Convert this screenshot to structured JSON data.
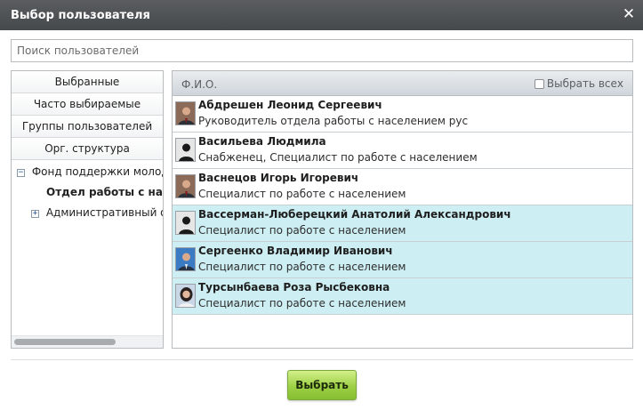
{
  "dialog": {
    "title": "Выбор пользователя"
  },
  "search": {
    "placeholder": "Поиск пользователей",
    "value": ""
  },
  "sidebar": {
    "items": [
      {
        "label": "Выбранные"
      },
      {
        "label": "Часто выбираемые"
      },
      {
        "label": "Группы пользователей"
      },
      {
        "label": "Орг. структура"
      }
    ],
    "tree": [
      {
        "label": "Фонд поддержки молоде",
        "toggle": "−",
        "expanded": true
      },
      {
        "label": "Отдел работы с нас",
        "toggle": "",
        "active": true
      },
      {
        "label": "Административный от",
        "toggle": "+",
        "expanded": false
      }
    ]
  },
  "list": {
    "header_label": "Ф.И.О.",
    "select_all_label": "Выбрать всех",
    "users": [
      {
        "name": "Абдрешен Леонид Сергеевич",
        "role": "Руководитель отдела работы с населением рус",
        "selected": false,
        "avatar": "photo-man-suit"
      },
      {
        "name": "Васильева Людмила",
        "role": "Снабженец, Специалист по работе с населением",
        "selected": false,
        "avatar": "silhouette"
      },
      {
        "name": "Васнецов Игорь Игоревич",
        "role": "Специалист по работе с населением",
        "selected": false,
        "avatar": "photo-man-suit"
      },
      {
        "name": "Вассерман-Люберецкий Анатолий Александрович",
        "role": "Специалист по работе с населением",
        "selected": true,
        "avatar": "silhouette"
      },
      {
        "name": "Сергеенко Владимир Иванович",
        "role": "Специалист по работе с населением",
        "selected": true,
        "avatar": "photo-man-blue"
      },
      {
        "name": "Турсынбаева Роза Рысбековна",
        "role": "Специалист по работе с населением",
        "selected": true,
        "avatar": "photo-woman"
      }
    ]
  },
  "footer": {
    "submit_label": "Выбрать"
  },
  "colors": {
    "titlebar": "#4f5255",
    "selected_row": "#cdeef3",
    "button": "#9dd046"
  }
}
